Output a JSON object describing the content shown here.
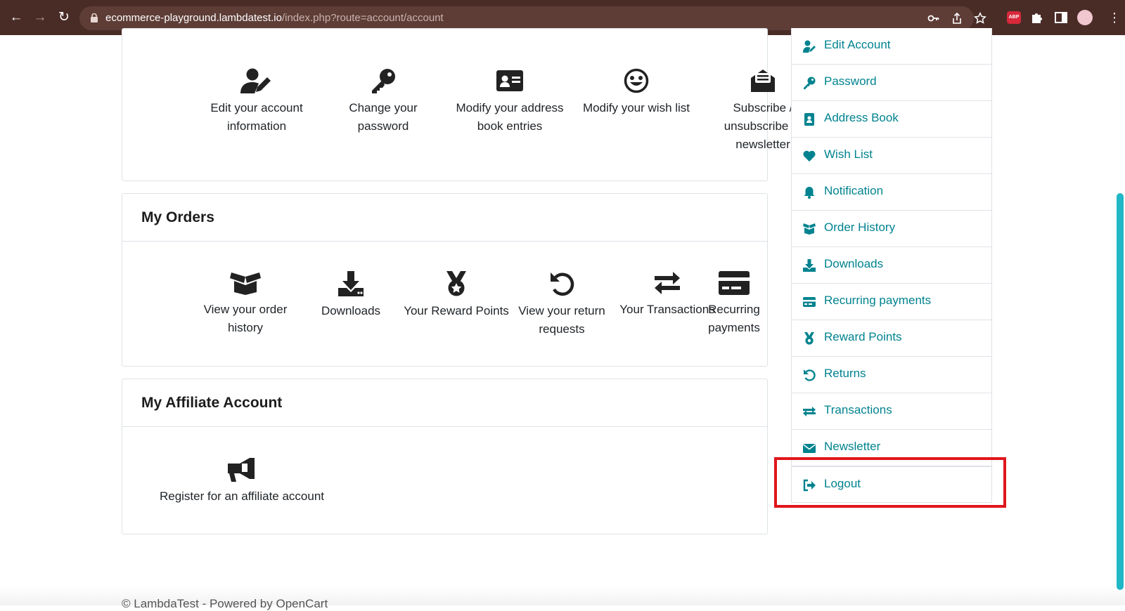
{
  "browser": {
    "url_host": "ecommerce-playground.lambdatest.io",
    "url_path": "/index.php?route=account/account",
    "extension_badge": "ABP"
  },
  "account_tiles": [
    {
      "icon": "user-edit-icon",
      "label": "Edit your account information"
    },
    {
      "icon": "key-icon",
      "label": "Change your password"
    },
    {
      "icon": "address-card-icon",
      "label": "Modify your address book entries"
    },
    {
      "icon": "smile-icon",
      "label": "Modify your wish list"
    },
    {
      "icon": "envelope-open-icon",
      "label": "Subscribe / unsubscribe to newsletter"
    }
  ],
  "orders": {
    "title": "My Orders",
    "tiles": [
      {
        "icon": "box-open-icon",
        "label": "View your order history"
      },
      {
        "icon": "download-icon",
        "label": "Downloads"
      },
      {
        "icon": "medal-icon",
        "label": "Your Reward Points"
      },
      {
        "icon": "undo-icon",
        "label": "View your return requests"
      },
      {
        "icon": "exchange-icon",
        "label": "Your Transactions"
      },
      {
        "icon": "credit-card-icon",
        "label": "Recurring payments"
      }
    ]
  },
  "affiliate": {
    "title": "My Affiliate Account",
    "tiles": [
      {
        "icon": "bullhorn-icon",
        "label": "Register for an affiliate account"
      }
    ]
  },
  "sidebar": {
    "items": [
      {
        "icon": "user-edit-icon",
        "label": "Edit Account"
      },
      {
        "icon": "key-icon",
        "label": "Password"
      },
      {
        "icon": "address-book-icon",
        "label": "Address Book"
      },
      {
        "icon": "heart-icon",
        "label": "Wish List"
      },
      {
        "icon": "bell-icon",
        "label": "Notification"
      },
      {
        "icon": "box-open-icon",
        "label": "Order History"
      },
      {
        "icon": "download-icon",
        "label": "Downloads"
      },
      {
        "icon": "credit-card-icon",
        "label": "Recurring payments"
      },
      {
        "icon": "medal-icon",
        "label": "Reward Points"
      },
      {
        "icon": "undo-icon",
        "label": "Returns"
      },
      {
        "icon": "exchange-icon",
        "label": "Transactions"
      },
      {
        "icon": "envelope-icon",
        "label": "Newsletter"
      },
      {
        "icon": "sign-out-icon",
        "label": "Logout"
      }
    ]
  },
  "footer": {
    "text": "© LambdaTest - Powered by OpenCart"
  },
  "colors": {
    "accent": "#00838f",
    "highlight": "#e0161b",
    "chrome": "#4a2c27",
    "scrollbar": "#21b7c6"
  }
}
